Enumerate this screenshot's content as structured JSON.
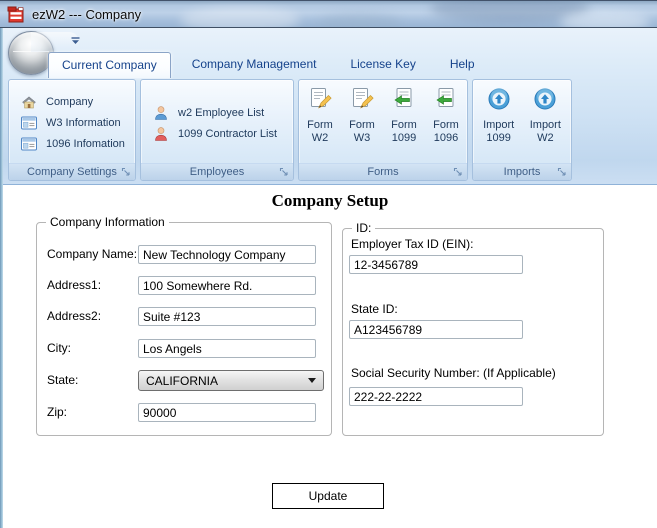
{
  "window": {
    "title": "ezW2 --- Company",
    "app_icon": "ezw2-app-icon"
  },
  "quick_access": {
    "dropdown_icon": "qat-dropdown-arrow-icon"
  },
  "ribbon": {
    "tabs": [
      {
        "label": "Current Company",
        "selected": true
      },
      {
        "label": "Company Management",
        "selected": false
      },
      {
        "label": "License Key",
        "selected": false
      },
      {
        "label": "Help",
        "selected": false
      }
    ],
    "groups": [
      {
        "label": "Company Settings",
        "items": [
          {
            "label": "Company",
            "icon": "house-icon"
          },
          {
            "label": "W3 Information",
            "icon": "form-list-icon"
          },
          {
            "label": "1096 Infomation",
            "icon": "form-list-icon"
          }
        ]
      },
      {
        "label": "Employees",
        "items": [
          {
            "label": "w2 Employee List",
            "icon": "person-blue-icon"
          },
          {
            "label": "1099 Contractor List",
            "icon": "person-red-icon"
          }
        ]
      },
      {
        "label": "Forms",
        "items": [
          {
            "line1": "Form",
            "line2": "W2",
            "icon": "form-edit-icon"
          },
          {
            "line1": "Form",
            "line2": "W3",
            "icon": "form-edit-icon"
          },
          {
            "line1": "Form",
            "line2": "1099",
            "icon": "form-green-arrow-icon"
          },
          {
            "line1": "Form",
            "line2": "1096",
            "icon": "form-green-arrow-icon"
          }
        ]
      },
      {
        "label": "Imports",
        "items": [
          {
            "line1": "Import",
            "line2": "1099",
            "icon": "import-up-icon"
          },
          {
            "line1": "Import",
            "line2": "W2",
            "icon": "import-up-icon"
          }
        ]
      }
    ]
  },
  "content": {
    "heading": "Company Setup",
    "company_info": {
      "legend": "Company Information",
      "fields": [
        {
          "label": "Company Name:",
          "value": "New Technology Company"
        },
        {
          "label": "Address1:",
          "value": "100 Somewhere Rd."
        },
        {
          "label": "Address2:",
          "value": "Suite #123"
        },
        {
          "label": "City:",
          "value": "Los Angels"
        },
        {
          "label": "State:",
          "value": "CALIFORNIA"
        },
        {
          "label": "Zip:",
          "value": "90000"
        }
      ]
    },
    "ids": {
      "legend": "ID:",
      "fields": [
        {
          "label": "Employer Tax ID (EIN):",
          "value": "12-3456789"
        },
        {
          "label": "State ID:",
          "value": "A123456789"
        },
        {
          "label": "Social Security Number: (If Applicable)",
          "value": "222-22-2222"
        }
      ]
    },
    "update_button": "Update"
  },
  "colors": {
    "ribbon_text": "#15428b",
    "group_label_text": "#3f5e86",
    "titlebar_blue": "#aac4e0",
    "selected_tab_bg": "#ffffff",
    "title_icon_red": "#d9352a"
  }
}
